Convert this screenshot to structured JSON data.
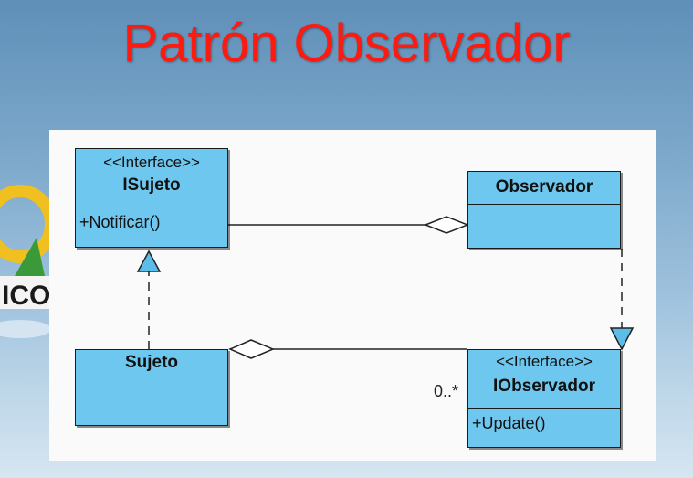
{
  "slide": {
    "title": "Patrón Observador"
  },
  "logo": {
    "text": "ICO"
  },
  "diagram": {
    "classes": {
      "isujeto": {
        "stereotype": "<<Interface>>",
        "name": "ISujeto",
        "operation": "+Notificar()"
      },
      "observador": {
        "name": "Observador"
      },
      "sujeto": {
        "name": "Sujeto"
      },
      "iobservador": {
        "stereotype": "<<Interface>>",
        "name": "IObservador",
        "operation": "+Update()"
      }
    },
    "multiplicity": "0..*"
  }
}
